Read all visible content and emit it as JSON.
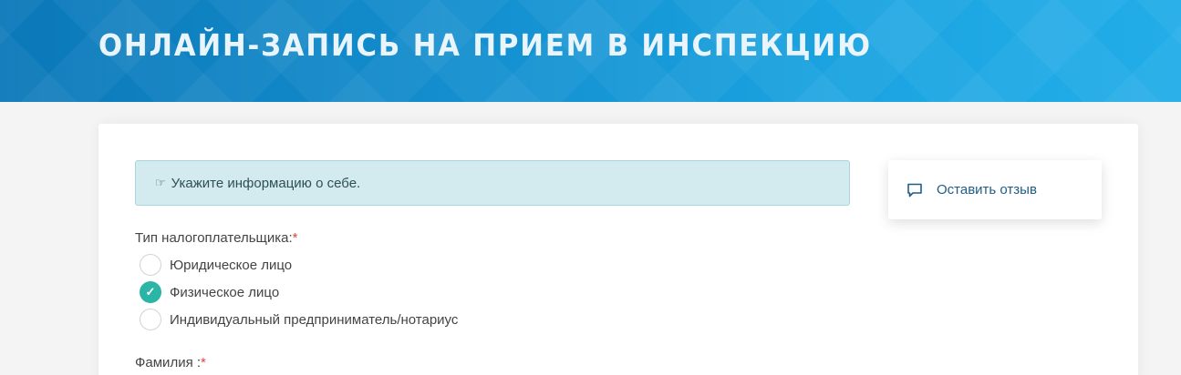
{
  "header": {
    "title": "ОНЛАЙН-ЗАПИСЬ НА ПРИЕМ В ИНСПЕКЦИЮ"
  },
  "notice": {
    "icon": "hand-pointing-icon",
    "text": "Укажите информацию о себе."
  },
  "taxpayer_type": {
    "label": "Тип налогоплательщика:",
    "required_mark": "*",
    "options": [
      {
        "label": "Юридическое лицо",
        "checked": false
      },
      {
        "label": "Физическое лицо",
        "checked": true
      },
      {
        "label": "Индивидуальный предприниматель/нотариус",
        "checked": false
      }
    ]
  },
  "surname": {
    "label": "Фамилия :",
    "required_mark": "*"
  },
  "feedback": {
    "icon": "speech-bubble-icon",
    "label": "Оставить отзыв"
  },
  "colors": {
    "banner": "#138ccc",
    "accent_teal": "#2bb5a7",
    "notice_bg": "#d3ebef",
    "link": "#1f5d86",
    "required": "#e0453c"
  }
}
